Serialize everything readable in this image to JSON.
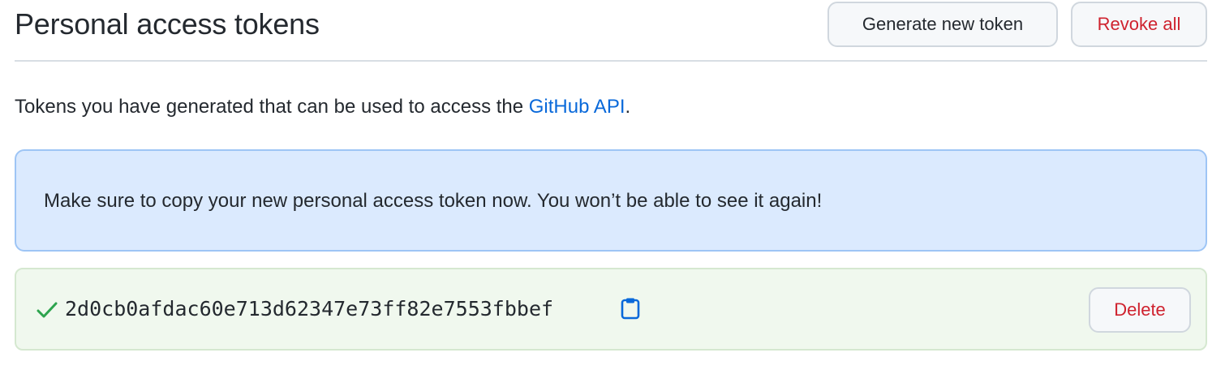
{
  "header": {
    "title": "Personal access tokens",
    "generate_label": "Generate new token",
    "revoke_label": "Revoke all"
  },
  "description": {
    "prefix": "Tokens you have generated that can be used to access the ",
    "link_text": "GitHub API",
    "suffix": "."
  },
  "flash": {
    "message": "Make sure to copy your new personal access token now. You won’t be able to see it again!"
  },
  "token": {
    "value": "2d0cb0afdac60e713d62347e73ff82e7553fbbef",
    "delete_label": "Delete",
    "status_icon": "check-icon",
    "copy_icon": "clipboard-icon"
  },
  "colors": {
    "link": "#0969da",
    "danger": "#cf222e",
    "flash_bg": "#dbeafe",
    "flash_border": "#9ec5f5",
    "token_bg": "#f0f8ee",
    "success": "#2da44e"
  }
}
